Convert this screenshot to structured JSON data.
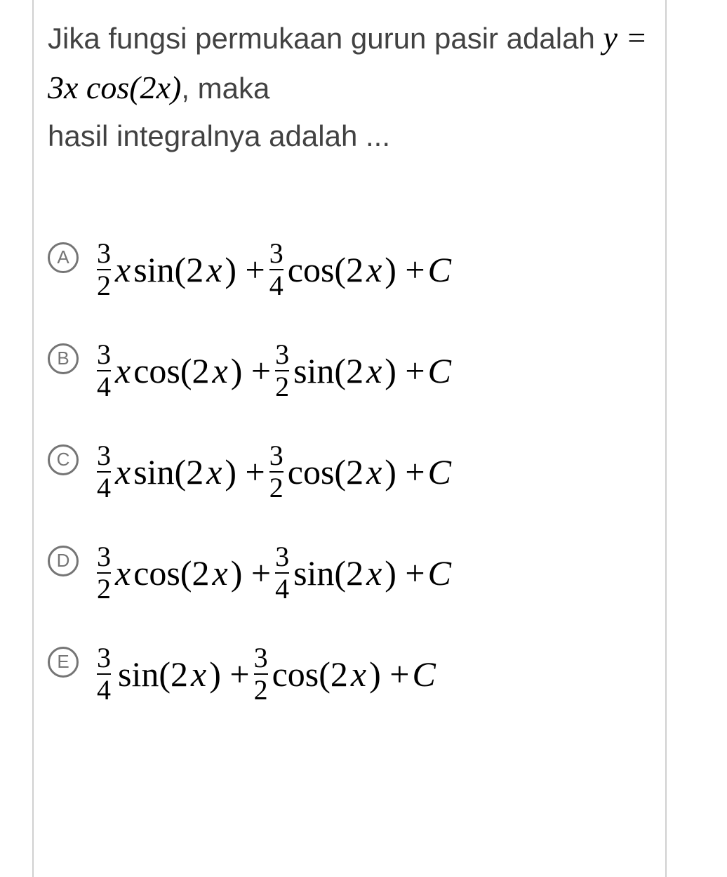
{
  "question": {
    "prefix": "Jika fungsi permukaan gurun pasir adalah ",
    "formula_y": "y",
    "formula_eq": " = ",
    "formula_rhs_coef": "3",
    "formula_rhs_var": "x",
    "formula_rhs_func": " cos(2",
    "formula_rhs_var2": "x",
    "formula_rhs_close": ")",
    "suffix1": ", maka",
    "line3": "hasil integralnya adalah ..."
  },
  "options": [
    {
      "label": "A",
      "frac1_num": "3",
      "frac1_den": "2",
      "term1_var": "x",
      "term1_func": " sin(2",
      "term1_var2": "x",
      "term1_close": ") + ",
      "frac2_num": "3",
      "frac2_den": "4",
      "term2_func": "cos(2",
      "term2_var": "x",
      "term2_close": ") + ",
      "const": "C"
    },
    {
      "label": "B",
      "frac1_num": "3",
      "frac1_den": "4",
      "term1_var": "x",
      "term1_func": " cos(2",
      "term1_var2": "x",
      "term1_close": ") + ",
      "frac2_num": "3",
      "frac2_den": "2",
      "term2_func": "sin(2",
      "term2_var": "x",
      "term2_close": ") + ",
      "const": "C"
    },
    {
      "label": "C",
      "frac1_num": "3",
      "frac1_den": "4",
      "term1_var": "x",
      "term1_func": " sin(2",
      "term1_var2": "x",
      "term1_close": ") + ",
      "frac2_num": "3",
      "frac2_den": "2",
      "term2_func": "cos(2",
      "term2_var": "x",
      "term2_close": ") + ",
      "const": "C"
    },
    {
      "label": "D",
      "frac1_num": "3",
      "frac1_den": "2",
      "term1_var": "x",
      "term1_func": " cos(2",
      "term1_var2": "x",
      "term1_close": ") + ",
      "frac2_num": "3",
      "frac2_den": "4",
      "term2_func": "sin(2",
      "term2_var": "x",
      "term2_close": ") + ",
      "const": "C"
    },
    {
      "label": "E",
      "frac1_num": "3",
      "frac1_den": "4",
      "term1_var": "",
      "term1_func": "sin(2",
      "term1_var2": "x",
      "term1_close": ") + ",
      "frac2_num": "3",
      "frac2_den": "2",
      "term2_func": "cos(2",
      "term2_var": "x",
      "term2_close": ") + ",
      "const": "C"
    }
  ]
}
